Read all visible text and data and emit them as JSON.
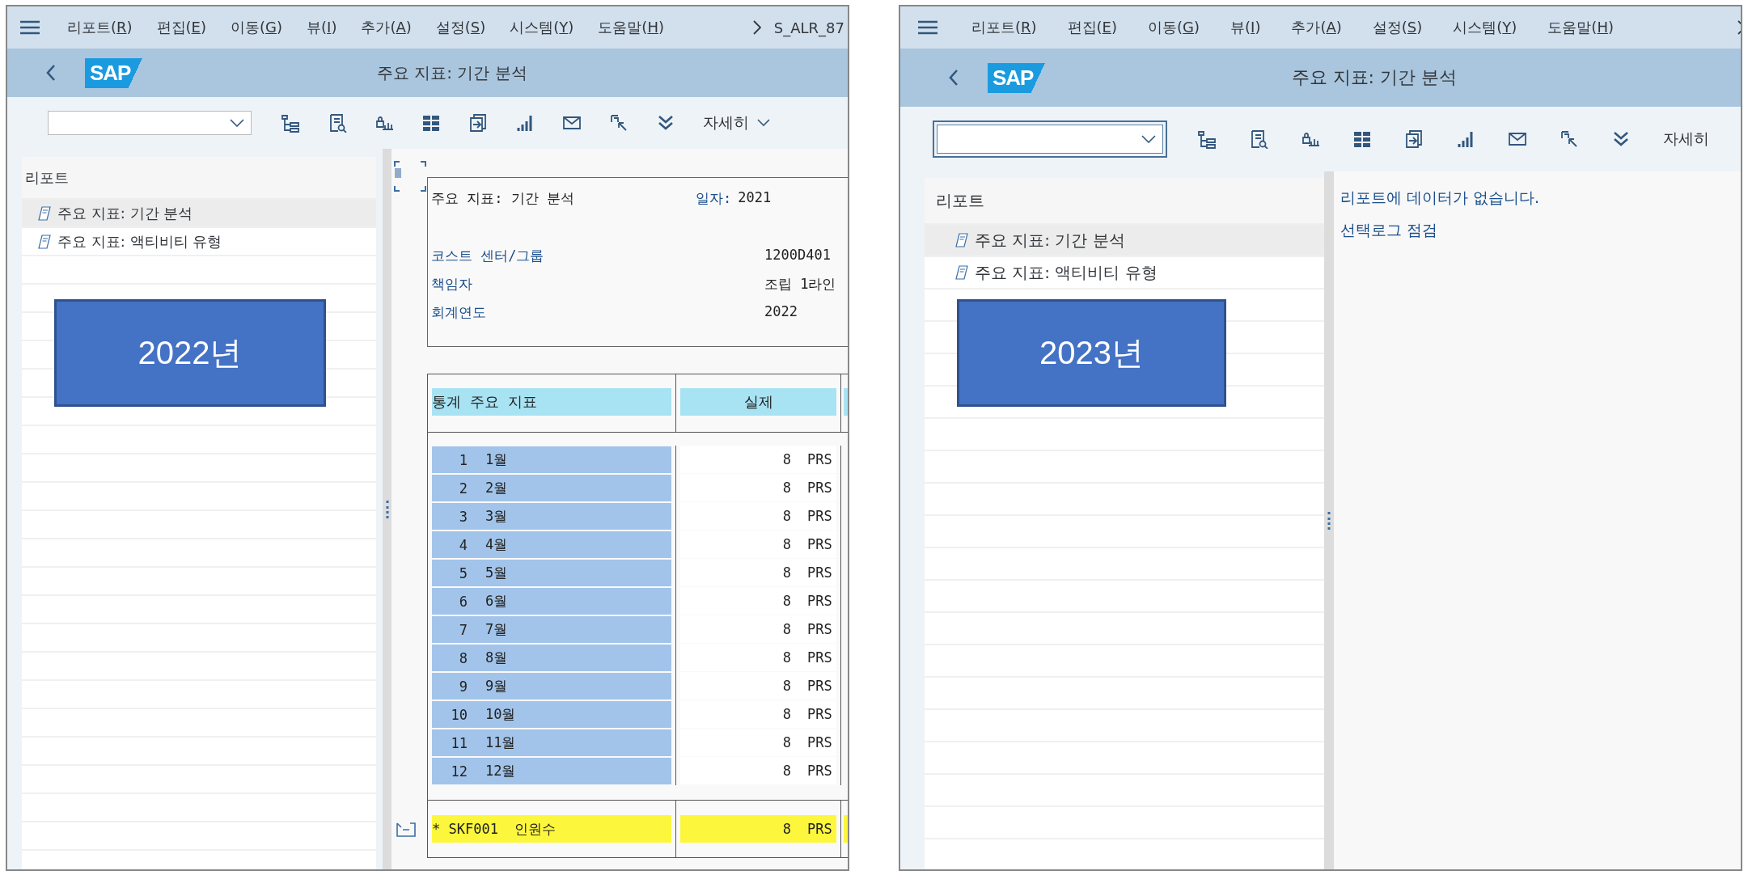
{
  "panels": [
    {
      "menu": [
        "리포트(R)",
        "편집(E)",
        "이동(G)",
        "뷰(I)",
        "추가(A)",
        "설정(S)",
        "시스템(Y)",
        "도움말(H)"
      ],
      "transaction": "S_ALR_87",
      "logo": "SAP",
      "title": "주요 지표: 기간 분석",
      "toolbar": {
        "field_focused": false,
        "more_label": "자세히",
        "more_caret": true
      },
      "sidebar": {
        "header": "리포트",
        "items": [
          {
            "label": "주요 지표: 기간 분석",
            "selected": true
          },
          {
            "label": "주요 지표: 액티비티 유형",
            "selected": false
          }
        ]
      },
      "callout": "2022년",
      "content": {
        "kind": "report",
        "title": "주요 지표: 기간 분석",
        "date_label": "일자:",
        "date_value": "2021",
        "fields": [
          {
            "label": "코스트 센터/그룹",
            "value": "1200D401"
          },
          {
            "label": "책임자",
            "value": "조립 1라인"
          },
          {
            "label": "회계연도",
            "value": "2022"
          }
        ],
        "columns": [
          "통계 주요 지표",
          "실제"
        ],
        "rows": [
          {
            "num": "1",
            "label": "1월",
            "value": "8",
            "unit": "PRS"
          },
          {
            "num": "2",
            "label": "2월",
            "value": "8",
            "unit": "PRS"
          },
          {
            "num": "3",
            "label": "3월",
            "value": "8",
            "unit": "PRS"
          },
          {
            "num": "4",
            "label": "4월",
            "value": "8",
            "unit": "PRS"
          },
          {
            "num": "5",
            "label": "5월",
            "value": "8",
            "unit": "PRS"
          },
          {
            "num": "6",
            "label": "6월",
            "value": "8",
            "unit": "PRS"
          },
          {
            "num": "7",
            "label": "7월",
            "value": "8",
            "unit": "PRS"
          },
          {
            "num": "8",
            "label": "8월",
            "value": "8",
            "unit": "PRS"
          },
          {
            "num": "9",
            "label": "9월",
            "value": "8",
            "unit": "PRS"
          },
          {
            "num": "10",
            "label": "10월",
            "value": "8",
            "unit": "PRS"
          },
          {
            "num": "11",
            "label": "11월",
            "value": "8",
            "unit": "PRS"
          },
          {
            "num": "12",
            "label": "12월",
            "value": "8",
            "unit": "PRS"
          }
        ],
        "total": {
          "label": "* SKF001  인원수",
          "value": "8",
          "unit": "PRS"
        }
      }
    },
    {
      "menu": [
        "리포트(R)",
        "편집(E)",
        "이동(G)",
        "뷰(I)",
        "추가(A)",
        "설정(S)",
        "시스템(Y)",
        "도움말(H)"
      ],
      "logo": "SAP",
      "title": "주요 지표: 기간 분석",
      "toolbar": {
        "field_focused": true,
        "more_label": "자세히",
        "more_caret": false
      },
      "sidebar": {
        "header": "리포트",
        "items": [
          {
            "label": "주요 지표: 기간 분석",
            "selected": true
          },
          {
            "label": "주요 지표: 액티비티 유형",
            "selected": false
          }
        ]
      },
      "callout": "2023년",
      "content": {
        "kind": "message",
        "lines": [
          "리포트에 데이터가 없습니다.",
          "선택로그 점검"
        ]
      }
    }
  ]
}
